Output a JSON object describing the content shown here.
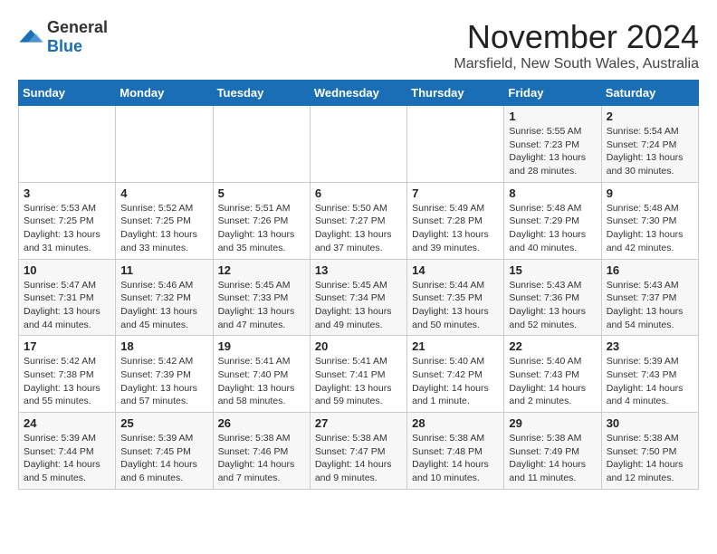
{
  "header": {
    "logo_general": "General",
    "logo_blue": "Blue",
    "month_title": "November 2024",
    "location": "Marsfield, New South Wales, Australia"
  },
  "days_of_week": [
    "Sunday",
    "Monday",
    "Tuesday",
    "Wednesday",
    "Thursday",
    "Friday",
    "Saturday"
  ],
  "weeks": [
    [
      {
        "day": "",
        "info": ""
      },
      {
        "day": "",
        "info": ""
      },
      {
        "day": "",
        "info": ""
      },
      {
        "day": "",
        "info": ""
      },
      {
        "day": "",
        "info": ""
      },
      {
        "day": "1",
        "info": "Sunrise: 5:55 AM\nSunset: 7:23 PM\nDaylight: 13 hours and 28 minutes."
      },
      {
        "day": "2",
        "info": "Sunrise: 5:54 AM\nSunset: 7:24 PM\nDaylight: 13 hours and 30 minutes."
      }
    ],
    [
      {
        "day": "3",
        "info": "Sunrise: 5:53 AM\nSunset: 7:25 PM\nDaylight: 13 hours and 31 minutes."
      },
      {
        "day": "4",
        "info": "Sunrise: 5:52 AM\nSunset: 7:25 PM\nDaylight: 13 hours and 33 minutes."
      },
      {
        "day": "5",
        "info": "Sunrise: 5:51 AM\nSunset: 7:26 PM\nDaylight: 13 hours and 35 minutes."
      },
      {
        "day": "6",
        "info": "Sunrise: 5:50 AM\nSunset: 7:27 PM\nDaylight: 13 hours and 37 minutes."
      },
      {
        "day": "7",
        "info": "Sunrise: 5:49 AM\nSunset: 7:28 PM\nDaylight: 13 hours and 39 minutes."
      },
      {
        "day": "8",
        "info": "Sunrise: 5:48 AM\nSunset: 7:29 PM\nDaylight: 13 hours and 40 minutes."
      },
      {
        "day": "9",
        "info": "Sunrise: 5:48 AM\nSunset: 7:30 PM\nDaylight: 13 hours and 42 minutes."
      }
    ],
    [
      {
        "day": "10",
        "info": "Sunrise: 5:47 AM\nSunset: 7:31 PM\nDaylight: 13 hours and 44 minutes."
      },
      {
        "day": "11",
        "info": "Sunrise: 5:46 AM\nSunset: 7:32 PM\nDaylight: 13 hours and 45 minutes."
      },
      {
        "day": "12",
        "info": "Sunrise: 5:45 AM\nSunset: 7:33 PM\nDaylight: 13 hours and 47 minutes."
      },
      {
        "day": "13",
        "info": "Sunrise: 5:45 AM\nSunset: 7:34 PM\nDaylight: 13 hours and 49 minutes."
      },
      {
        "day": "14",
        "info": "Sunrise: 5:44 AM\nSunset: 7:35 PM\nDaylight: 13 hours and 50 minutes."
      },
      {
        "day": "15",
        "info": "Sunrise: 5:43 AM\nSunset: 7:36 PM\nDaylight: 13 hours and 52 minutes."
      },
      {
        "day": "16",
        "info": "Sunrise: 5:43 AM\nSunset: 7:37 PM\nDaylight: 13 hours and 54 minutes."
      }
    ],
    [
      {
        "day": "17",
        "info": "Sunrise: 5:42 AM\nSunset: 7:38 PM\nDaylight: 13 hours and 55 minutes."
      },
      {
        "day": "18",
        "info": "Sunrise: 5:42 AM\nSunset: 7:39 PM\nDaylight: 13 hours and 57 minutes."
      },
      {
        "day": "19",
        "info": "Sunrise: 5:41 AM\nSunset: 7:40 PM\nDaylight: 13 hours and 58 minutes."
      },
      {
        "day": "20",
        "info": "Sunrise: 5:41 AM\nSunset: 7:41 PM\nDaylight: 13 hours and 59 minutes."
      },
      {
        "day": "21",
        "info": "Sunrise: 5:40 AM\nSunset: 7:42 PM\nDaylight: 14 hours and 1 minute."
      },
      {
        "day": "22",
        "info": "Sunrise: 5:40 AM\nSunset: 7:43 PM\nDaylight: 14 hours and 2 minutes."
      },
      {
        "day": "23",
        "info": "Sunrise: 5:39 AM\nSunset: 7:43 PM\nDaylight: 14 hours and 4 minutes."
      }
    ],
    [
      {
        "day": "24",
        "info": "Sunrise: 5:39 AM\nSunset: 7:44 PM\nDaylight: 14 hours and 5 minutes."
      },
      {
        "day": "25",
        "info": "Sunrise: 5:39 AM\nSunset: 7:45 PM\nDaylight: 14 hours and 6 minutes."
      },
      {
        "day": "26",
        "info": "Sunrise: 5:38 AM\nSunset: 7:46 PM\nDaylight: 14 hours and 7 minutes."
      },
      {
        "day": "27",
        "info": "Sunrise: 5:38 AM\nSunset: 7:47 PM\nDaylight: 14 hours and 9 minutes."
      },
      {
        "day": "28",
        "info": "Sunrise: 5:38 AM\nSunset: 7:48 PM\nDaylight: 14 hours and 10 minutes."
      },
      {
        "day": "29",
        "info": "Sunrise: 5:38 AM\nSunset: 7:49 PM\nDaylight: 14 hours and 11 minutes."
      },
      {
        "day": "30",
        "info": "Sunrise: 5:38 AM\nSunset: 7:50 PM\nDaylight: 14 hours and 12 minutes."
      }
    ]
  ]
}
